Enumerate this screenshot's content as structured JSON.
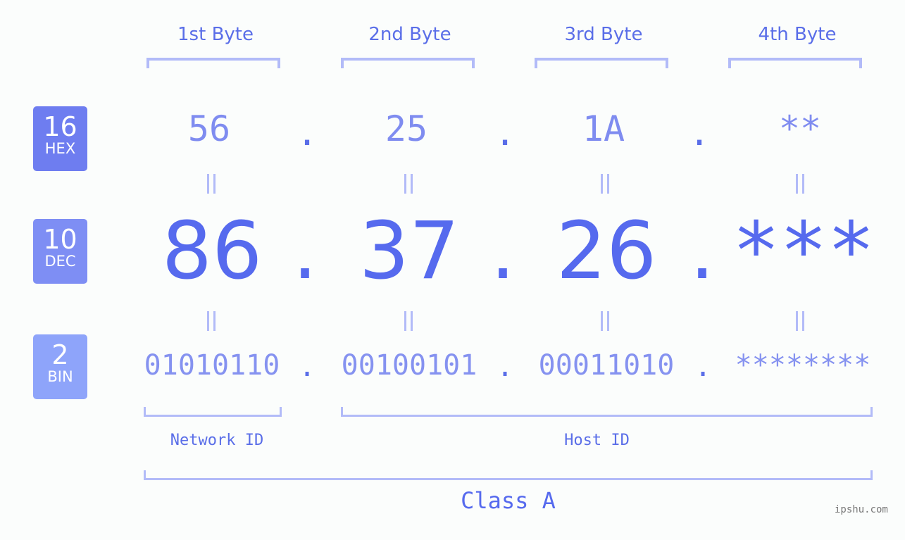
{
  "bases": [
    {
      "number": "16",
      "label": "HEX",
      "color": "#6e7df0"
    },
    {
      "number": "10",
      "label": "DEC",
      "color": "#7e8ef4"
    },
    {
      "number": "2",
      "label": "BIN",
      "color": "#8ea4fa"
    }
  ],
  "byte_headers": [
    "1st Byte",
    "2nd Byte",
    "3rd Byte",
    "4th Byte"
  ],
  "hex": [
    "56",
    "25",
    "1A",
    "**"
  ],
  "dec": [
    "86",
    "37",
    "26",
    "***"
  ],
  "bin": [
    "01010110",
    "00100101",
    "00011010",
    "********"
  ],
  "separator": ".",
  "network_id_label": "Network ID",
  "host_id_label": "Host ID",
  "class_label": "Class A",
  "watermark": "ipshu.com",
  "colors": {
    "accent": "#566aee",
    "bracket": "#b2bbf8",
    "background": "#fbfdfc"
  }
}
